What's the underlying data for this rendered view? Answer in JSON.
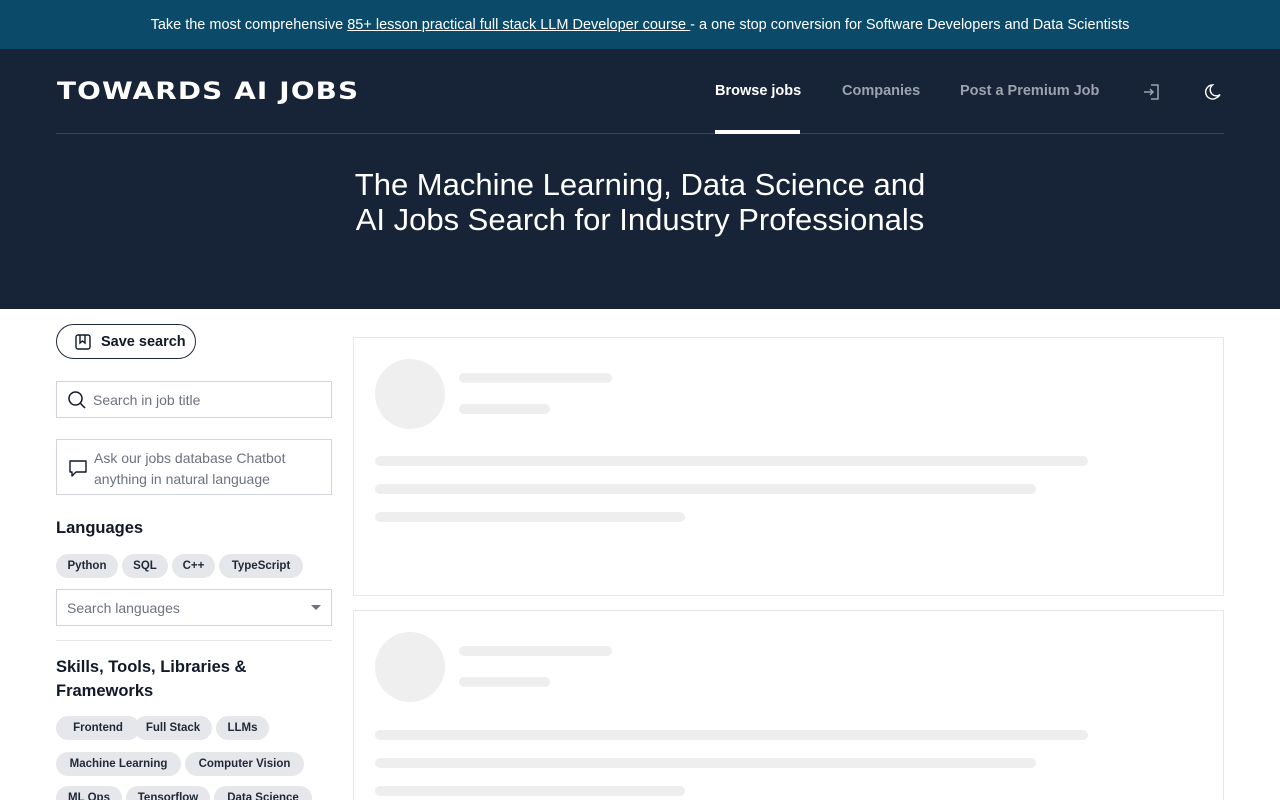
{
  "promo": {
    "prefix": "Take the most comprehensive ",
    "link_text": "85+ lesson practical full stack LLM Developer course ",
    "suffix": "- a one stop conversion for Software Developers and Data Scientists"
  },
  "header": {
    "logo": "TOWARDS AI JOBS",
    "nav": {
      "browse_jobs": "Browse jobs",
      "companies": "Companies",
      "post_job": "Post a Premium Job"
    },
    "icons": [
      "sign-in-icon",
      "moon-icon"
    ],
    "hero_title": "The Machine Learning, Data Science and AI Jobs Search for Industry Professionals"
  },
  "sidebar": {
    "save_search": "Save search",
    "search_placeholder": "Search in job title",
    "chatbot_placeholder": "Ask our jobs database Chatbot anything in natural language",
    "languages": {
      "title": "Languages",
      "chips": [
        "Python",
        "SQL",
        "C++",
        "TypeScript"
      ],
      "select_placeholder": "Search languages"
    },
    "skills": {
      "title": "Skills, Tools, Libraries & Frameworks",
      "chips": [
        "Frontend",
        "Full Stack",
        "LLMs",
        "Machine Learning",
        "Computer Vision",
        "ML Ops",
        "Tensorflow",
        "Data Science"
      ]
    }
  },
  "colors": {
    "promo_bg": "#0b4a68",
    "header_bg": "#172336",
    "chip_bg": "#e5e7eb",
    "skeleton": "#eeeeee"
  }
}
